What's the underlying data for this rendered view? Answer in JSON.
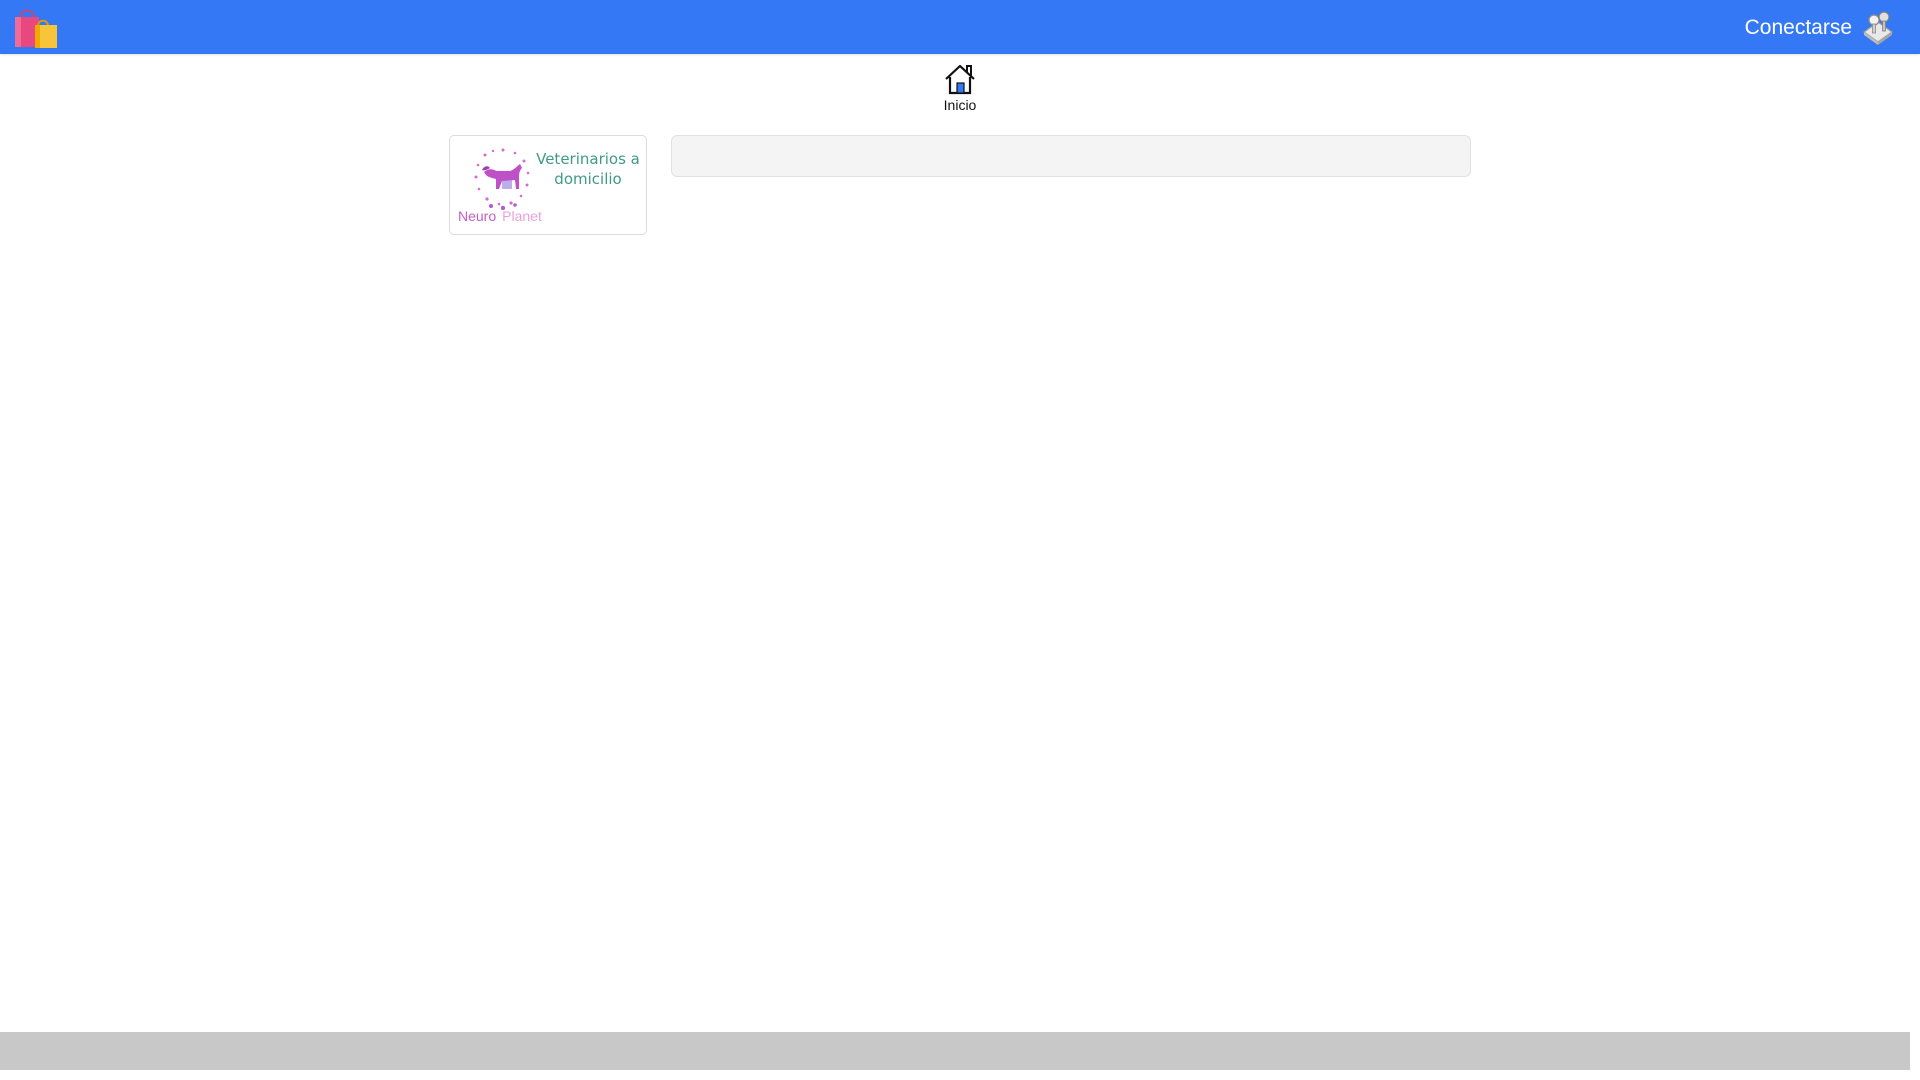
{
  "header": {
    "logo_icon": "shopping-bags-icon",
    "connect_label": "Conectarse",
    "connect_icon": "login-keys-icon",
    "background": "#3478f6"
  },
  "nav": {
    "home_label": "Inicio",
    "home_icon": "house-icon"
  },
  "cards": [
    {
      "title": "Veterinarios a domicilio",
      "brand_first": "Neuro",
      "brand_second": "Planet",
      "image_icon": "dog-circle-logo-icon",
      "title_color": "#3f9a85"
    }
  ],
  "panel": {
    "background": "#f4f4f4"
  },
  "footer": {
    "background": "#c8c8c8"
  }
}
